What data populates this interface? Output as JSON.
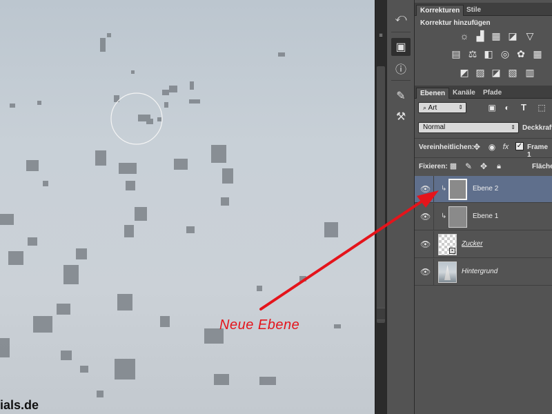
{
  "canvas": {
    "watermark": "ials.de"
  },
  "tools": {
    "items": [
      {
        "icon": "history-icon"
      },
      {
        "icon": "3d-cube-icon"
      },
      {
        "icon": "info-icon"
      },
      {
        "icon": "brush-presets-icon"
      },
      {
        "icon": "tool-presets-icon"
      }
    ]
  },
  "adjustments_panel": {
    "tabs": [
      "Korrekturen",
      "Stile"
    ],
    "title": "Korrektur hinzufügen",
    "icons": [
      "brightness-icon",
      "levels-icon",
      "curves-icon",
      "exposure-icon",
      "triangle-icon",
      "vibrance-icon",
      "balance-icon",
      "black-white-icon",
      "photo-filter-icon",
      "channel-mixer-icon",
      "color-lookup-icon",
      "invert-icon",
      "posterize-icon",
      "threshold-icon",
      "gradient-map-icon",
      "selective-color-icon"
    ]
  },
  "layers_panel": {
    "tabs": [
      "Ebenen",
      "Kanäle",
      "Pfade"
    ],
    "filter": {
      "label": "Art"
    },
    "blend_mode": "Normal",
    "opacity_label": "Deckkraft",
    "unify_label": "Vereinheitlichen:",
    "frame_label": "Frame 1",
    "lock_label": "Fixieren:",
    "fill_label": "Fläche",
    "layers": [
      {
        "name": "Ebene 2",
        "selected": true,
        "clipped": true
      },
      {
        "name": "Ebene 1",
        "selected": false,
        "clipped": true
      },
      {
        "name": "Zucker",
        "selected": false,
        "clipped": false
      },
      {
        "name": "Hintergrund",
        "selected": false,
        "clipped": false
      }
    ]
  },
  "annotation": {
    "text": "Neue Ebene",
    "color": "#e4141b"
  }
}
